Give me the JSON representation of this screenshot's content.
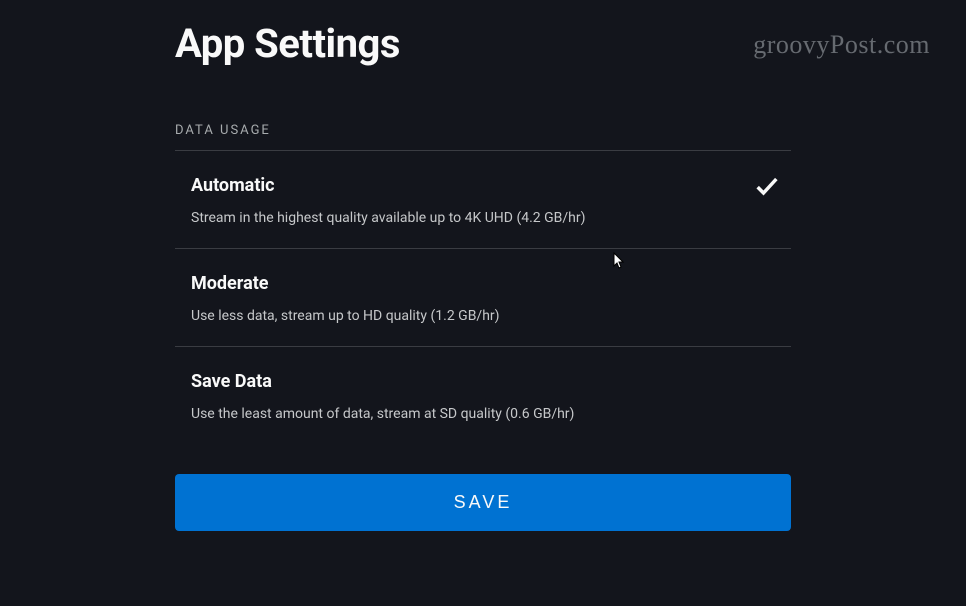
{
  "page_title": "App Settings",
  "watermark": "groovyPost.com",
  "section_header": "DATA USAGE",
  "options": [
    {
      "title": "Automatic",
      "description": "Stream in the highest quality available up to 4K UHD (4.2 GB/hr)",
      "selected": true
    },
    {
      "title": "Moderate",
      "description": "Use less data, stream up to HD quality (1.2 GB/hr)",
      "selected": false
    },
    {
      "title": "Save Data",
      "description": "Use the least amount of data, stream at SD quality (0.6 GB/hr)",
      "selected": false
    }
  ],
  "save_button_label": "SAVE",
  "colors": {
    "background": "#13151c",
    "primary_button": "#0072d2",
    "text_primary": "#f9f9f9",
    "text_secondary": "#c6c8ca",
    "divider": "#3a3c42"
  }
}
